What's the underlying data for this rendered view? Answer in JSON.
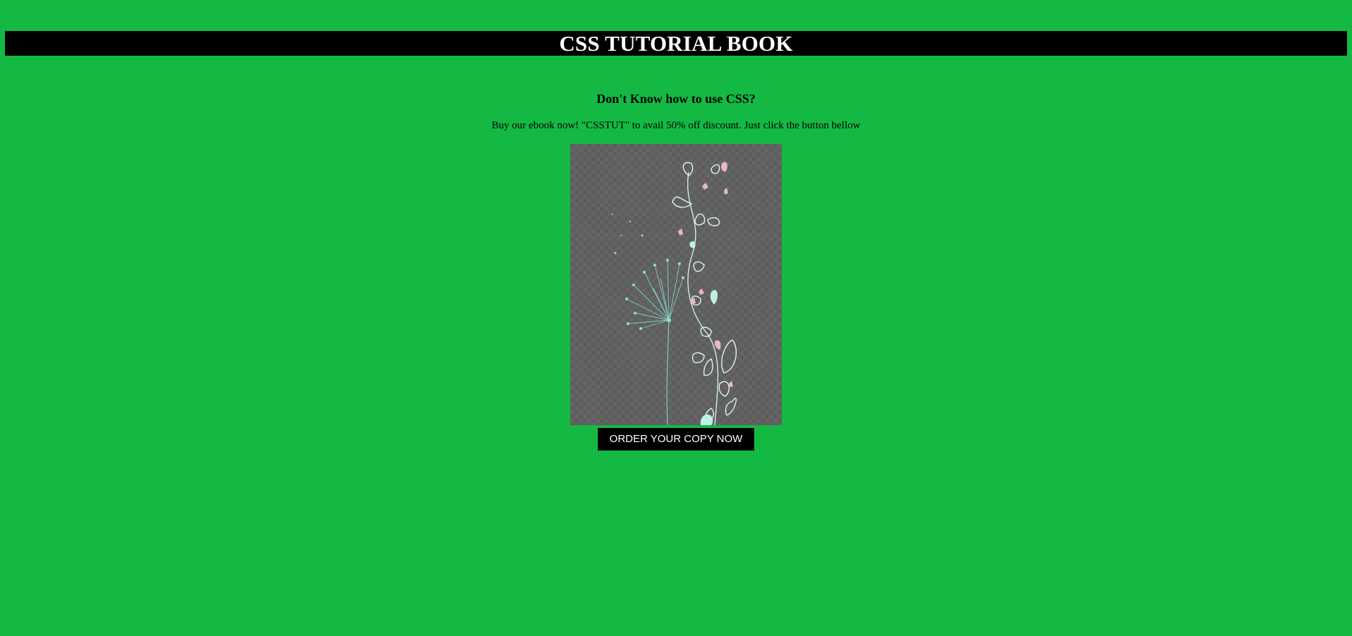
{
  "header": {
    "title": "CSS TUTORIAL BOOK"
  },
  "main": {
    "heading": "Don't Know how to use CSS?",
    "promo_text": "Buy our ebook now! \"CSSTUT\" to avail 50% off discount. Just click the button bellow",
    "order_button_label": "ORDER YOUR COPY NOW"
  },
  "colors": {
    "background": "#14b944",
    "title_bar": "#000000",
    "title_text": "#ffffff",
    "button": "#000000",
    "cover_bg": "#5d5d5d"
  }
}
